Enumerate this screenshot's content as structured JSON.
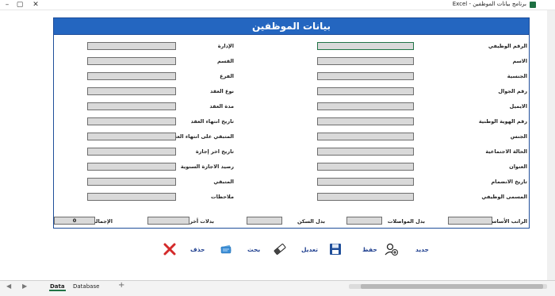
{
  "app": {
    "title": "برنامج بيانات الموظفين - Excel"
  },
  "form": {
    "title": "بيانات الموظفين",
    "right_labels": [
      "الرقم الوظيفي",
      "الاسم",
      "الجنسية",
      "رقم الجوال",
      "الايميل",
      "رقم الهوية الوطنية",
      "الجنس",
      "الحالة الاجتماعية",
      "العنوان",
      "تاريخ الانضمام",
      "المسمى الوظيفي"
    ],
    "left_labels": [
      "الإدارة",
      "القسم",
      "الفرع",
      "نوع العقد",
      "مدة العقد",
      "تاريخ انتهاء العقد",
      "المتبقي على انتهاء العقد بالاشهر",
      "تاريخ اخر إجازة",
      "رصيد الاجازة السنوية",
      "المتبقي",
      "ملاحظات"
    ],
    "totals": {
      "basic_salary": "الراتب الأساسي",
      "transport": "بدل المواصلات",
      "housing": "بدل السكن",
      "other": "بدلات أخرى",
      "total": "الإجمالي",
      "total_value": "0"
    }
  },
  "toolbar": {
    "new": "جديد",
    "save": "حفظ",
    "edit": "تعديل",
    "search": "بحث",
    "delete": "حذف"
  },
  "sheets": {
    "tabs": [
      "Data",
      "Database"
    ],
    "add": "+",
    "active": "Data"
  }
}
